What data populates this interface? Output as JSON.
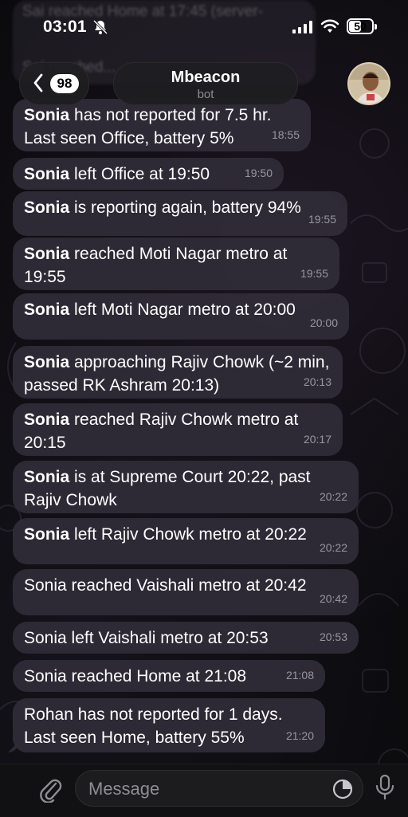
{
  "status_bar": {
    "time": "03:01",
    "battery_level": "50"
  },
  "ghost_messages": [
    "Sai reached Home at 17:45 (server-",
    "Sai reached..."
  ],
  "header": {
    "back_count": "98",
    "chat_name": "Mbeacon",
    "chat_subtitle": "bot"
  },
  "messages": [
    {
      "name": "Sonia",
      "text": " has not reported for 7.5 hr. Last seen Office, battery 5%",
      "time": "18:55"
    },
    {
      "name": "Sonia",
      "text": " left Office at 19:50",
      "time": "19:50"
    },
    {
      "name": "Sonia",
      "text": " is reporting again, battery 94%",
      "time": "19:55"
    },
    {
      "name": "Sonia",
      "text": " reached Moti Nagar metro at 19:55",
      "time": "19:55"
    },
    {
      "name": "Sonia",
      "text": " left  Moti Nagar metro at 20:00",
      "time": "20:00"
    },
    {
      "name": "Sonia",
      "text": " approaching Rajiv Chowk (~2 min, passed RK Ashram 20:13)",
      "time": "20:13"
    },
    {
      "name": "Sonia",
      "text": " reached Rajiv Chowk metro at 20:15",
      "time": "20:17"
    },
    {
      "name": "Sonia",
      "text": " is at Supreme Court 20:22, past Rajiv Chowk",
      "time": "20:22"
    },
    {
      "name": "Sonia",
      "text": " left Rajiv Chowk metro at 20:22",
      "time": "20:22"
    },
    {
      "name": "",
      "text": "Sonia reached Vaishali metro at 20:42",
      "time": "20:42"
    },
    {
      "name": "",
      "text": "Sonia left Vaishali metro at 20:53",
      "time": "20:53"
    },
    {
      "name": "",
      "text": "Sonia reached Home at 21:08",
      "time": "21:08"
    },
    {
      "name": "",
      "text": "Rohan has not reported for 1 days. Last seen Home, battery 55%",
      "time": "21:20"
    }
  ],
  "composer": {
    "placeholder": "Message"
  },
  "icons": {
    "back": "chevron-left-icon",
    "mute": "bell-slash-icon",
    "attach": "paperclip-icon",
    "sticker": "sticker-clock-icon",
    "mic": "microphone-icon"
  }
}
